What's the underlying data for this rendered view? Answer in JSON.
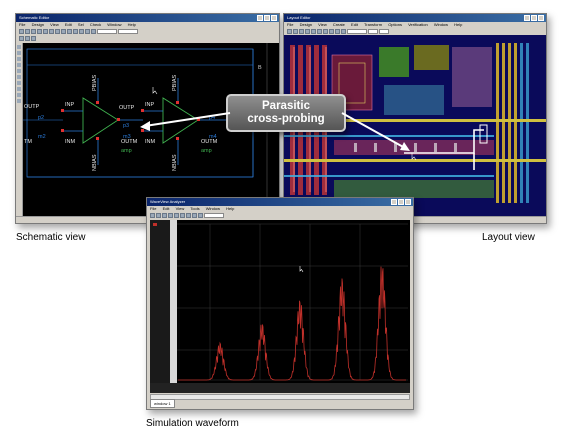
{
  "schematic_window": {
    "title": "Schematic Editor",
    "menu": [
      "File",
      "Design",
      "View",
      "Edit",
      "Sel",
      "Check",
      "Window",
      "Help"
    ],
    "labels": {
      "outp_left": "OUTP",
      "inp1": "INP",
      "inm1": "INM",
      "pbias1": "PBIAS",
      "nbias1": "NBIAS",
      "outp_mid": "OUTP",
      "inp2": "INP",
      "inm2": "INM",
      "pbias2": "PBIAS",
      "nbias2": "NBIAS",
      "outm1": "OUTM",
      "outm2": "OUTM",
      "amp1": "amp",
      "amp2": "amp",
      "left_m": "TM",
      "p2": "p2",
      "m2": "m2",
      "p3": "p3",
      "m3": "m3",
      "p4": "p4",
      "m4": "m4",
      "corner": "B"
    }
  },
  "layout_window": {
    "title": "Layout Editor",
    "menu": [
      "File",
      "Design",
      "View",
      "Create",
      "Edit",
      "Transform",
      "Options",
      "Verification",
      "Window",
      "Help"
    ]
  },
  "waveform_window": {
    "title": "WaveView Analyzer",
    "menu": [
      "File",
      "Edit",
      "View",
      "Tools",
      "Window",
      "Help"
    ],
    "tab_label": "window 1"
  },
  "callout": {
    "line1": "Parasitic",
    "line2": "cross-probing"
  },
  "captions": {
    "schematic": "Schematic view",
    "layout": "Layout view",
    "waveform": "Simulation waveform"
  },
  "colors": {
    "canvas": "#000000",
    "schematic_wire": "#2b7bd8",
    "schematic_symbol": "#3fb04f",
    "schematic_pin": "#e03030",
    "waveform_trace": "#c0302a",
    "titlebar": "#0a246a"
  }
}
